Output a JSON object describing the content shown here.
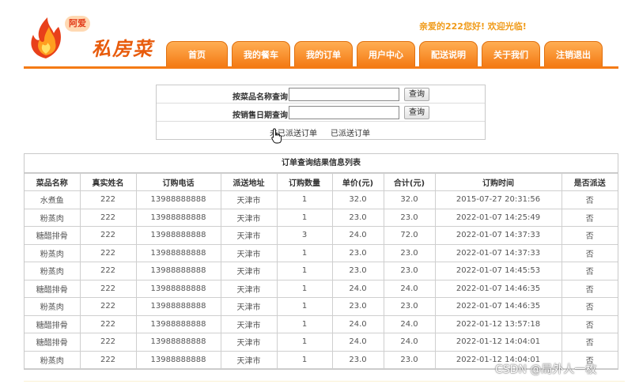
{
  "logo": {
    "badge": "阿爱",
    "brand": "私房菜"
  },
  "welcome": "亲爱的222您好! 欢迎光临!",
  "nav": [
    "首页",
    "我的餐车",
    "我的订单",
    "用户中心",
    "配送说明",
    "关于我们",
    "注销退出"
  ],
  "search": {
    "by_name_label": "按菜品名称查询",
    "by_date_label": "按销售日期查询",
    "query_button": "查询",
    "name_value": "",
    "date_value": "",
    "undelivered_link": "未已派送订单",
    "delivered_link": "已派送订单"
  },
  "table": {
    "title": "订单查询结果信息列表",
    "columns": [
      "菜品名称",
      "真实姓名",
      "订购电话",
      "派送地址",
      "订购数量",
      "单价(元)",
      "合计(元)",
      "订购时间",
      "是否派送"
    ],
    "rows": [
      [
        "水煮鱼",
        "222",
        "13988888888",
        "天津市",
        "1",
        "32.0",
        "32.0",
        "2015-07-27 20:31:56",
        "否"
      ],
      [
        "粉蒸肉",
        "222",
        "13988888888",
        "天津市",
        "1",
        "23.0",
        "23.0",
        "2022-01-07 14:25:49",
        "否"
      ],
      [
        "糖醋排骨",
        "222",
        "13988888888",
        "天津市",
        "3",
        "24.0",
        "72.0",
        "2022-01-07 14:37:33",
        "否"
      ],
      [
        "粉蒸肉",
        "222",
        "13988888888",
        "天津市",
        "1",
        "23.0",
        "23.0",
        "2022-01-07 14:37:33",
        "否"
      ],
      [
        "粉蒸肉",
        "222",
        "13988888888",
        "天津市",
        "1",
        "23.0",
        "23.0",
        "2022-01-07 14:45:53",
        "否"
      ],
      [
        "糖醋排骨",
        "222",
        "13988888888",
        "天津市",
        "1",
        "24.0",
        "24.0",
        "2022-01-07 14:46:35",
        "否"
      ],
      [
        "粉蒸肉",
        "222",
        "13988888888",
        "天津市",
        "1",
        "23.0",
        "23.0",
        "2022-01-07 14:46:35",
        "否"
      ],
      [
        "糖醋排骨",
        "222",
        "13988888888",
        "天津市",
        "1",
        "24.0",
        "24.0",
        "2022-01-12 13:57:18",
        "否"
      ],
      [
        "糖醋排骨",
        "222",
        "13988888888",
        "天津市",
        "1",
        "24.0",
        "24.0",
        "2022-01-12 14:04:01",
        "否"
      ],
      [
        "粉蒸肉",
        "222",
        "13988888888",
        "天津市",
        "1",
        "23.0",
        "23.0",
        "2022-01-12 14:04:01",
        "否"
      ]
    ]
  },
  "watermark": "CSDN @局外人一枚",
  "colors": {
    "accent": "#f47b15",
    "welcome_text": "#f09b1a"
  }
}
